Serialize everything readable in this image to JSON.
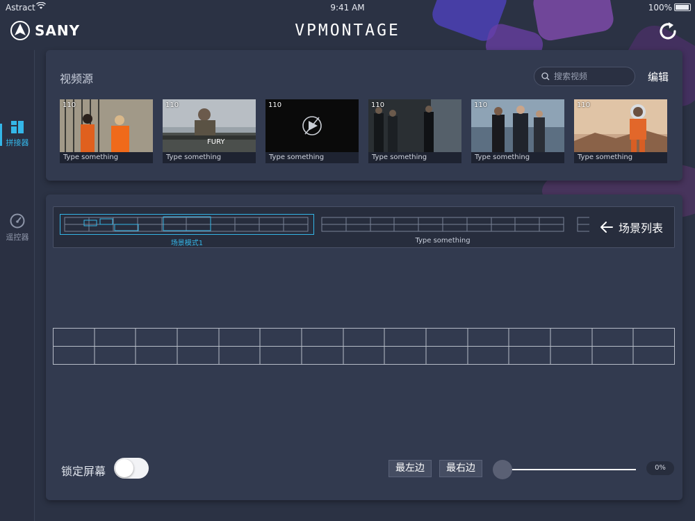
{
  "statusbar": {
    "carrier": "Astract",
    "time": "9:41 AM",
    "battery": "100%"
  },
  "header": {
    "brand": "SANY",
    "app_title": "VPMONTAGE",
    "refresh_icon": "refresh-icon"
  },
  "sidebar": {
    "items": [
      {
        "label": "拼接器",
        "icon": "grid-layout-icon",
        "active": true
      },
      {
        "label": "遥控器",
        "icon": "gauge-icon",
        "active": false
      }
    ]
  },
  "video_source": {
    "title": "视频源",
    "search_placeholder": "搜索视频",
    "edit_label": "编辑",
    "thumbnails": [
      {
        "number": "110",
        "caption": "Type something",
        "scene": "prison"
      },
      {
        "number": "110",
        "caption": "Type something",
        "scene": "fury"
      },
      {
        "number": "110",
        "caption": "Type something",
        "scene": "blank-play"
      },
      {
        "number": "110",
        "caption": "Type something",
        "scene": "office-dark"
      },
      {
        "number": "110",
        "caption": "Type something",
        "scene": "office-window"
      },
      {
        "number": "110",
        "caption": "Type something",
        "scene": "astronaut"
      }
    ]
  },
  "scenes": {
    "items": [
      {
        "label": "场景模式1",
        "selected": true
      },
      {
        "label": "Type something",
        "selected": false
      }
    ],
    "list_button_label": "场景列表"
  },
  "controls": {
    "lock_label": "锁定屏幕",
    "lock_on": false,
    "leftmost_label": "最左边",
    "rightmost_label": "最右边",
    "slider_value": 0,
    "percent_text": "0%"
  },
  "colors": {
    "accent": "#34b6e8",
    "background": "#2b3244",
    "panel": "#323a4f"
  }
}
